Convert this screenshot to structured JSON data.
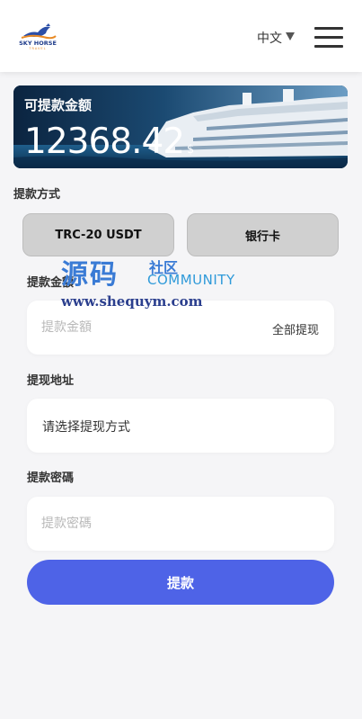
{
  "header": {
    "logo_text": "SKY HORSE",
    "logo_subtext": "TRAVEL",
    "language_label": "中文",
    "caret_icon": "caret-down-icon",
    "menu_icon": "hamburger-menu-icon"
  },
  "balance": {
    "label": "可提款金额",
    "amount": "12368.42",
    "currency_symbol": "$"
  },
  "method": {
    "section_label": "提款方式",
    "options": [
      "TRC-20 USDT",
      "银行卡"
    ]
  },
  "amount_field": {
    "label": "提款金額",
    "placeholder": "提款金額",
    "withdraw_all_label": "全部提现"
  },
  "address_field": {
    "label": "提现地址",
    "value": "请选择提现方式"
  },
  "password_field": {
    "label": "提款密碼",
    "placeholder": "提款密碼"
  },
  "submit": {
    "label": "提款"
  },
  "watermark": {
    "main": "源码",
    "side": "社区",
    "side_en": "COMMUNITY",
    "url": "www.shequym.com"
  },
  "colors": {
    "primary_button": "#4e63e7",
    "method_button_bg": "#d0d0d0",
    "card_bg": "#0d2a45",
    "page_bg": "#f5f5f7"
  }
}
